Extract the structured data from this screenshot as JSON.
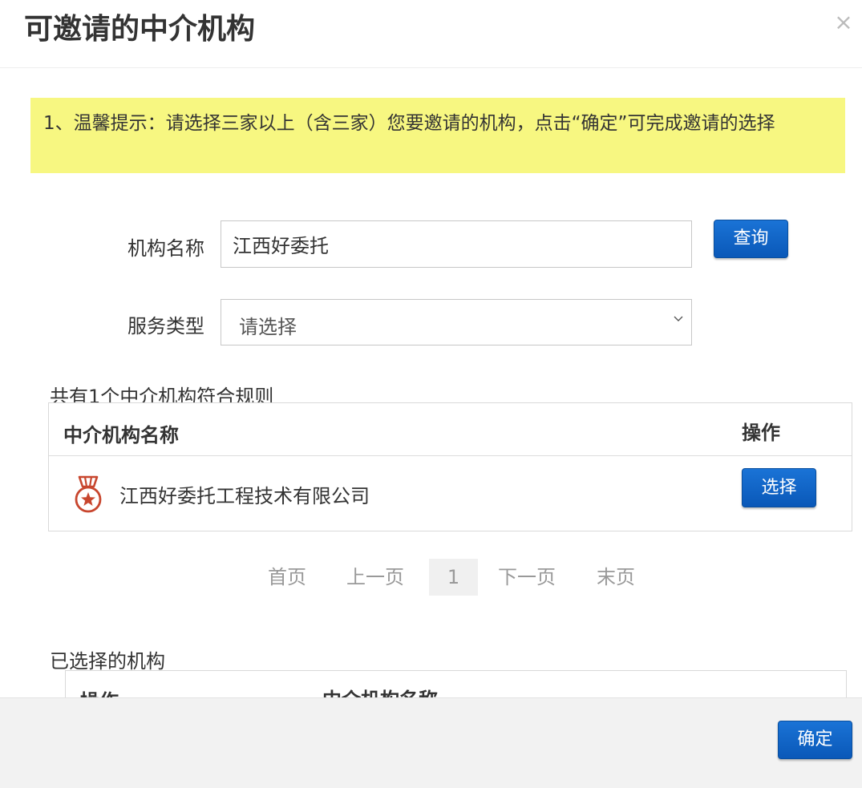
{
  "dialog": {
    "title": "可邀请的中介机构",
    "close_symbol": "×"
  },
  "tip": {
    "text": "1、温馨提示：请选择三家以上（含三家）您要邀请的机构，点击“确定”可完成邀请的选择"
  },
  "search_form": {
    "name_label": "机构名称",
    "name_value": "江西好委托",
    "query_button": "查询",
    "type_label": "服务类型",
    "type_value": "请选择"
  },
  "results": {
    "count_text": "共有1个中介机构符合规则",
    "columns": [
      "中介机构名称",
      "操作"
    ],
    "rows": [
      {
        "name": "江西好委托工程技术有限公司",
        "action": "选择",
        "icon": "medal-icon"
      }
    ]
  },
  "pagination": {
    "first": "首页",
    "prev": "上一页",
    "current": "1",
    "next": "下一页",
    "last": "末页"
  },
  "selected": {
    "title": "已选择的机构",
    "columns": [
      "操作",
      "中介机构名称"
    ]
  },
  "footer": {
    "confirm_button": "确定"
  },
  "colors": {
    "tip_background": "#f7f781",
    "primary_button": "#0a63c6",
    "medal": "#c8462e"
  }
}
